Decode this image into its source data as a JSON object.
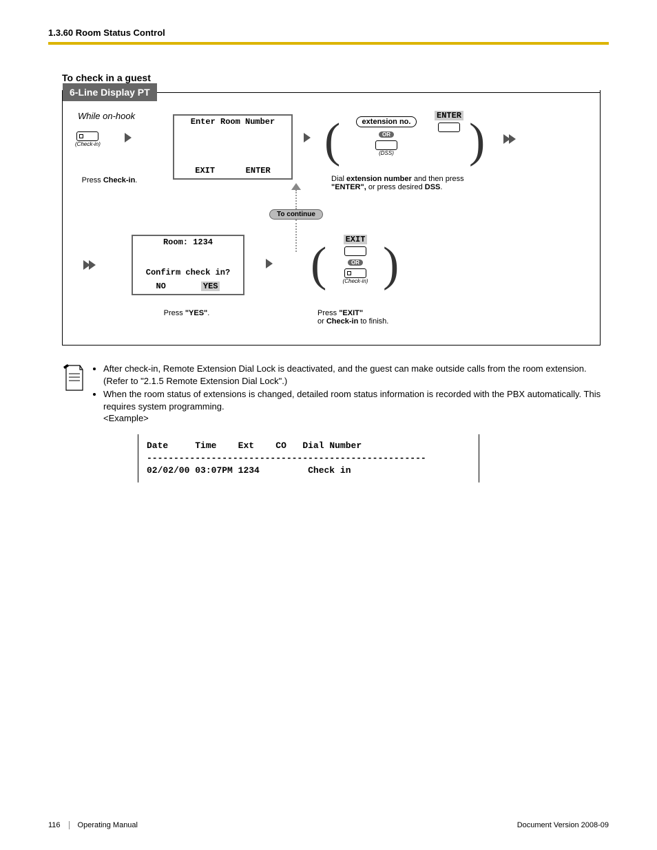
{
  "header": {
    "section": "1.3.60 Room Status Control"
  },
  "subheading": "To check in a guest",
  "box": {
    "title": "6-Line Display PT",
    "onhook": "While on-hook",
    "checkin_btn": "(Check-in)",
    "press_checkin": "Press Check-in.",
    "disp1_top": "Enter Room Number",
    "disp1_bl": "EXIT",
    "disp1_br": "ENTER",
    "ext_pill": "extension no.",
    "enter_btn": "ENTER",
    "or": "OR",
    "dss_btn": "(DSS)",
    "dial_caption_a": "Dial ",
    "dial_caption_b": "extension number",
    "dial_caption_c": " and then press ",
    "dial_caption_d": "\"ENTER\",",
    "dial_caption_e": " or press desired ",
    "dial_caption_f": "DSS",
    "to_continue": "To continue",
    "disp2_room": "Room: 1234",
    "disp2_q": "Confirm check in?",
    "disp2_no": "NO",
    "disp2_yes": "YES",
    "press_yes": "Press \"YES\".",
    "exit_btn": "EXIT",
    "finish_a": "Press ",
    "finish_b": "\"EXIT\"",
    "finish_c": "or ",
    "finish_d": "Check-in",
    "finish_e": " to finish."
  },
  "notes": {
    "li1": "After check-in, Remote Extension Dial Lock is deactivated, and the guest can make outside calls from the room extension. (Refer to \"2.1.5  Remote Extension Dial Lock\".)",
    "li2": "When the room status of extensions is changed, detailed room status information is recorded with the PBX automatically. This requires system programming.",
    "example_label": "<Example>"
  },
  "table": {
    "hdr_date": "Date",
    "hdr_time": "Time",
    "hdr_ext": "Ext",
    "hdr_co": "CO",
    "hdr_dial": "Dial Number",
    "row_date": "02/02/00",
    "row_time": "03:07PM",
    "row_ext": "1234",
    "row_co": "",
    "row_dial": "Check in"
  },
  "footer": {
    "page": "116",
    "manual": "Operating Manual",
    "docver": "Document Version  2008-09"
  }
}
